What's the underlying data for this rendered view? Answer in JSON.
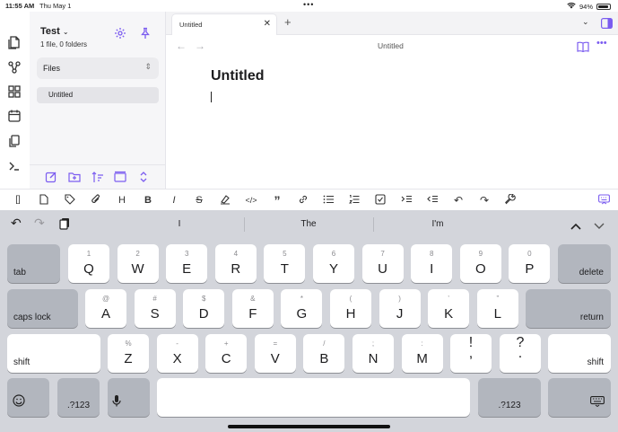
{
  "status": {
    "time": "11:55 AM",
    "date": "Thu May 1",
    "battery": "94%"
  },
  "sidebar": {
    "vault_name": "Test",
    "vault_sub": "1 file, 0 folders",
    "files_label": "Files",
    "file_items": [
      "Untitled"
    ]
  },
  "tabs": [
    {
      "label": "Untitled"
    }
  ],
  "editor": {
    "header_title": "Untitled",
    "heading": "Untitled"
  },
  "keyboard": {
    "suggestions": [
      "I",
      "The",
      "I'm"
    ],
    "row1": [
      {
        "main": "Q",
        "sub": "1"
      },
      {
        "main": "W",
        "sub": "2"
      },
      {
        "main": "E",
        "sub": "3"
      },
      {
        "main": "R",
        "sub": "4"
      },
      {
        "main": "T",
        "sub": "5"
      },
      {
        "main": "Y",
        "sub": "6"
      },
      {
        "main": "U",
        "sub": "7"
      },
      {
        "main": "I",
        "sub": "8"
      },
      {
        "main": "O",
        "sub": "9"
      },
      {
        "main": "P",
        "sub": "0"
      }
    ],
    "row2": [
      {
        "main": "A",
        "sub": "@"
      },
      {
        "main": "S",
        "sub": "#"
      },
      {
        "main": "D",
        "sub": "$"
      },
      {
        "main": "F",
        "sub": "&"
      },
      {
        "main": "G",
        "sub": "*"
      },
      {
        "main": "H",
        "sub": "("
      },
      {
        "main": "J",
        "sub": ")"
      },
      {
        "main": "K",
        "sub": "’"
      },
      {
        "main": "L",
        "sub": "”"
      }
    ],
    "row3": [
      {
        "main": "Z",
        "sub": "%"
      },
      {
        "main": "X",
        "sub": "-"
      },
      {
        "main": "C",
        "sub": "+"
      },
      {
        "main": "V",
        "sub": "="
      },
      {
        "main": "B",
        "sub": "/"
      },
      {
        "main": "N",
        "sub": ";"
      },
      {
        "main": "M",
        "sub": ":"
      }
    ],
    "punct1": {
      "top": "!",
      "bottom": ","
    },
    "punct2": {
      "top": "?",
      "bottom": "."
    },
    "tab_label": "tab",
    "delete_label": "delete",
    "caps_label": "caps lock",
    "return_label": "return",
    "shift_label": "shift",
    "numbers_label": ".?123"
  },
  "colors": {
    "accent": "#7b5cf0",
    "keyboard_bg": "#d3d5db"
  }
}
